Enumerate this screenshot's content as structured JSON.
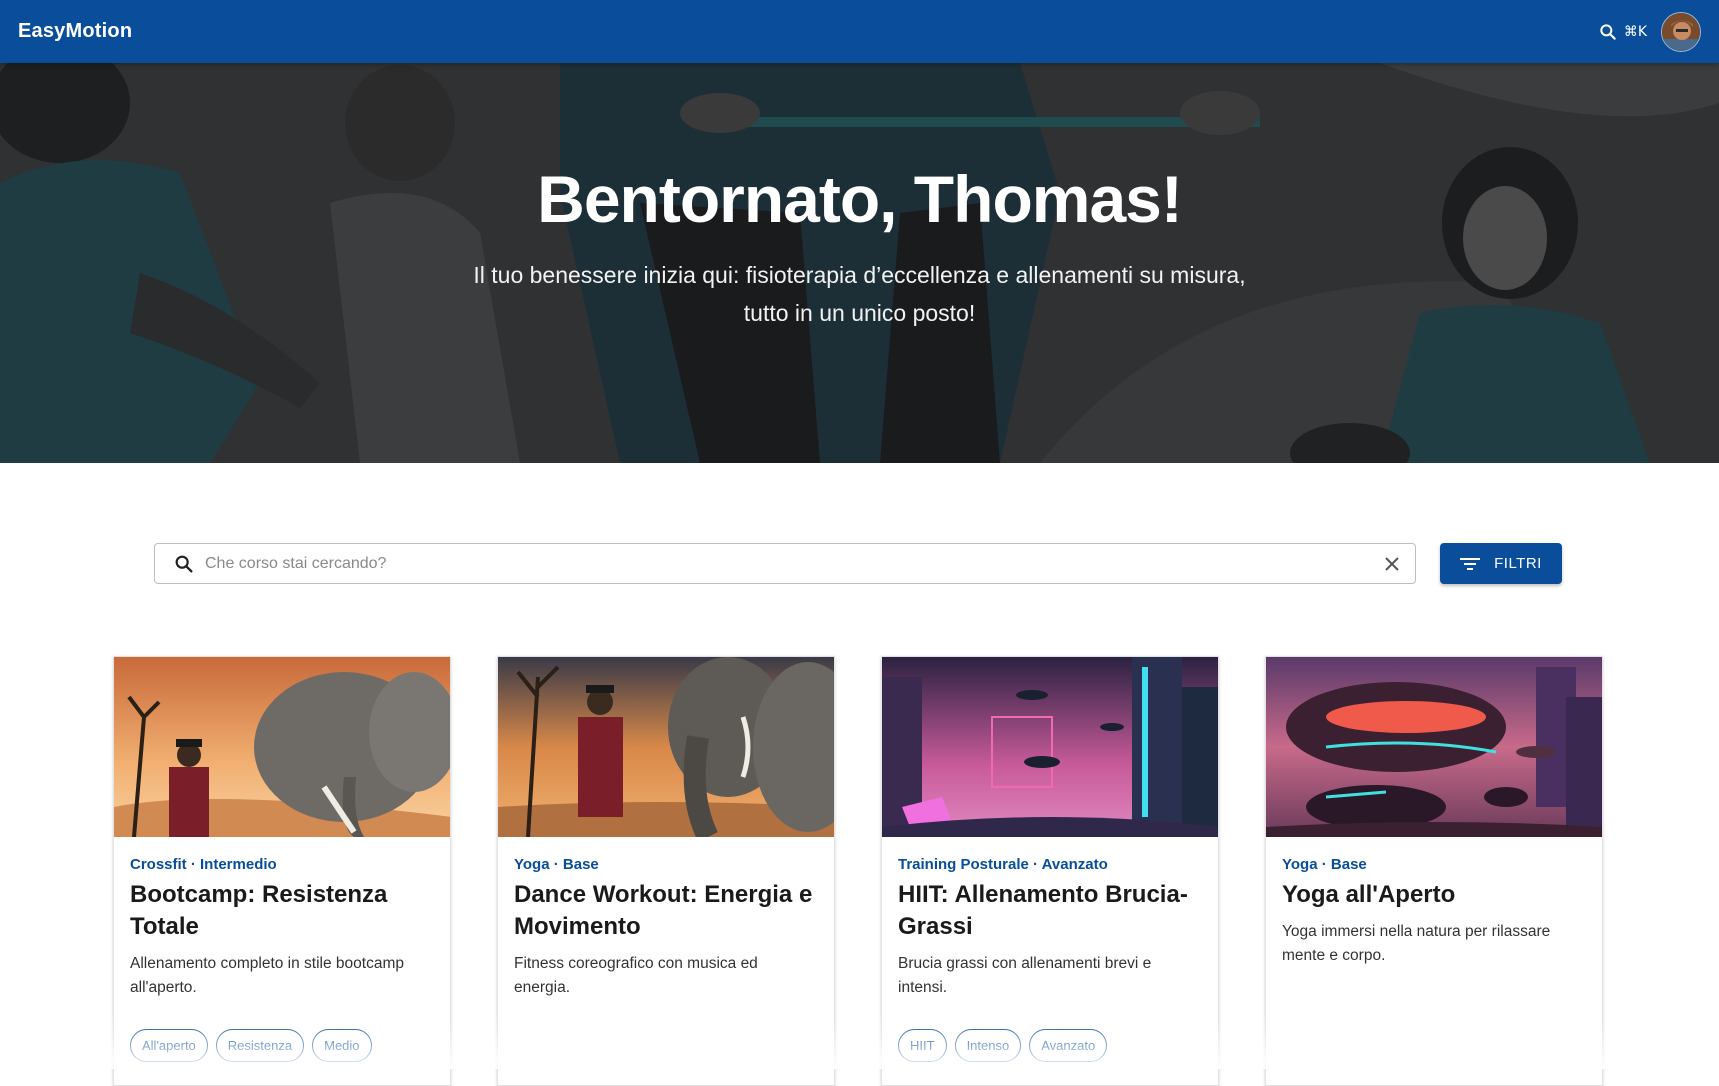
{
  "appbar": {
    "brand": "EasyMotion",
    "search_shortcut": "⌘K",
    "colors": {
      "primary": "#0a4e9b"
    }
  },
  "hero": {
    "title": "Bentornato, Thomas!",
    "subtitle_line1": "Il tuo benessere inizia qui: fisioterapia d’eccellenza e allenamenti su misura,",
    "subtitle_line2": "tutto in un unico posto!"
  },
  "search": {
    "placeholder": "Che corso stai cercando?",
    "value": "",
    "filter_label": "FILTRI"
  },
  "courses": [
    {
      "category": "Crossfit · Intermedio",
      "title": "Bootcamp: Resistenza Totale",
      "description": "Allenamento completo in stile bootcamp all'aperto.",
      "tags": [
        "All'aperto",
        "Resistenza",
        "Medio"
      ]
    },
    {
      "category": "Yoga · Base",
      "title": "Dance Workout: Energia e Movimento",
      "description": "Fitness coreografico con musica ed energia.",
      "tags": []
    },
    {
      "category": "Training Posturale · Avanzato",
      "title": "HIIT: Allenamento Brucia-Grassi",
      "description": "Brucia grassi con allenamenti brevi e intensi.",
      "tags": [
        "HIIT",
        "Intenso",
        "Avanzato"
      ]
    },
    {
      "category": "Yoga · Base",
      "title": "Yoga all'Aperto",
      "description": "Yoga immersi nella natura per rilassare mente e corpo.",
      "tags": []
    }
  ]
}
